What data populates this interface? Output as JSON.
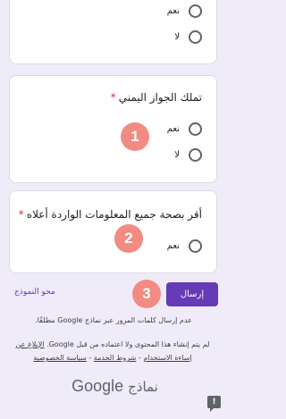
{
  "form": {
    "questions": [
      {
        "title": "",
        "options": [
          {
            "label": "نعم"
          },
          {
            "label": "لا"
          }
        ]
      },
      {
        "title": "تملك الجواز اليمني",
        "required_mark": "*",
        "options": [
          {
            "label": "نعم"
          },
          {
            "label": "لا"
          }
        ]
      },
      {
        "title": "أقر بصحة جميع المعلومات الواردة أعلاه",
        "required_mark": "*",
        "options": [
          {
            "label": "نعم"
          }
        ]
      }
    ],
    "submit_label": "إرسال",
    "clear_label": "محو النموذج"
  },
  "annotations": {
    "badges": [
      "1",
      "2",
      "3"
    ],
    "badge_color": "#f28b82"
  },
  "footer": {
    "no_password": "عدم إرسال كلمات المرور عبر نماذج Google مطلقًا.",
    "disclaimer": "لم يتم إنشاء هذا المحتوى ولا اعتماده من قبل Google.",
    "report_abuse": "الإبلاغ عن إساءة الاستخدام",
    "separator": " - ",
    "terms": "شروط الخدمة",
    "privacy": "سياسة الخصوصية",
    "brand_google": "Google",
    "brand_forms": "نماذج",
    "feedback_icon": "!"
  },
  "colors": {
    "accent": "#673ab7",
    "background": "#f0ebf8",
    "required": "#d93025"
  }
}
